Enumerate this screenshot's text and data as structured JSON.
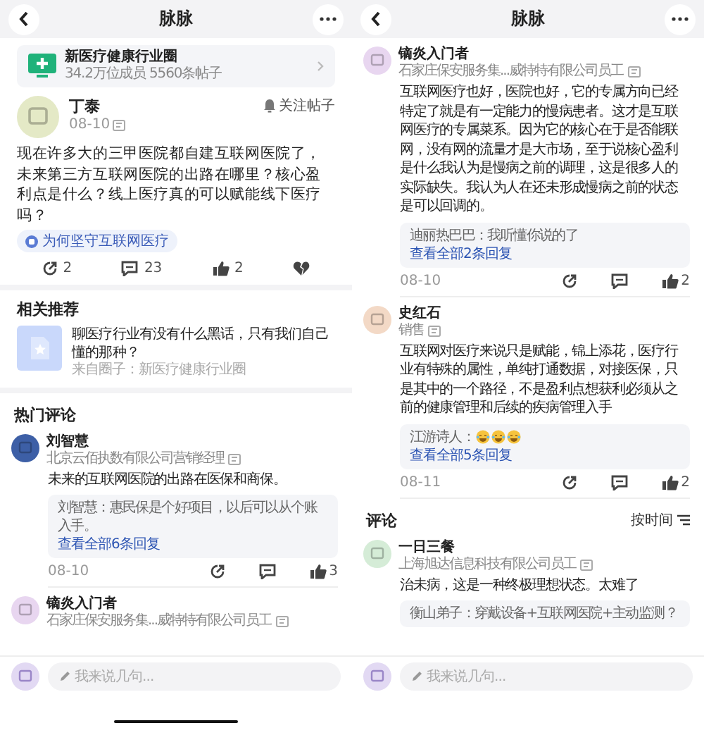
{
  "screens": [
    {
      "title": "脉脉",
      "home_indicator": true,
      "input": {
        "placeholder": "我来说几句..."
      },
      "blocks": [
        {
          "kind": "group",
          "name": "新医疗健康行业圈",
          "stats": "34.2万位成员 5560条帖子"
        },
        {
          "kind": "post",
          "author": "丁泰",
          "color": "#e4e9c6",
          "date": "08-10",
          "follow": "关注帖子",
          "text": "现在许多大的三甲医院都自建互联网医院了，未来第三方互联网医院的出路在哪里？核心盈利点是什么？线上医疗真的可以赋能线下医疗吗？",
          "tag": "为何坚守互联网医疗",
          "actions": [
            {
              "kind": "share",
              "count": "2"
            },
            {
              "kind": "comment",
              "count": "23"
            },
            {
              "kind": "like",
              "count": "2"
            },
            {
              "kind": "dislike"
            }
          ]
        },
        {
          "kind": "related",
          "title": "相关推荐",
          "text": "聊医疗行业有没有什么黑话，只有我们自己懂的那种？",
          "source": "来自圈子：新医疗健康行业圈"
        },
        {
          "kind": "section",
          "title": "热门评论"
        },
        {
          "kind": "comment",
          "author": "刘智慧",
          "color": "#3d5fa6",
          "subtitle": "北京云佰执数有限公司营销经理",
          "text": "未来的互联网医院的出路在医保和商保。",
          "reply": {
            "text": "刘智慧：惠民保是个好项目，以后可以从个账入手。",
            "more": "查看全部6条回复"
          },
          "date": "08-10",
          "like": "3"
        },
        {
          "kind": "comment",
          "author": "镝炎入门者",
          "color": "#e8d6f0",
          "subtitle": "石家庄保安服务集...威特特有限公司员工"
        }
      ]
    },
    {
      "title": "脉脉",
      "home_indicator": false,
      "input": {
        "placeholder": "我来说几句..."
      },
      "blocks": [
        {
          "kind": "comment",
          "author": "镝炎入门者",
          "color": "#e8d6f0",
          "subtitle": "石家庄保安服务集...威特特有限公司员工",
          "text": "互联网医疗也好，医院也好，它的专属方向已经特定了就是有一定能力的慢病患者。这才是互联网医疗的专属菜系。因为它的核心在于是否能联网，没有网的流量才是大市场，至于说核心盈利是什么我认为是慢病之前的调理，这是很多人的实际缺失。我认为人在还未形成慢病之前的状态是可以回调的。",
          "reply": {
            "text": "迪丽热巴巴：我听懂你说的了",
            "more": "查看全部2条回复"
          },
          "date": "08-10",
          "like": "2"
        },
        {
          "kind": "comment",
          "author": "史红石",
          "color": "#f3d9c6",
          "subtitle": "销售",
          "text": "互联网对医疗来说只是赋能，锦上添花，医疗行业有特殊的属性，单纯打通数据，对接医保，只是其中的一个路径，不是盈利点想获利必须从之前的健康管理和后续的疾病管理入手",
          "reply": {
            "text": "江游诗人：",
            "emojis": [
              {
                "kind": "laugh"
              },
              {
                "kind": "laugh"
              },
              {
                "kind": "laugh"
              }
            ],
            "more": "查看全部5条回复"
          },
          "date": "08-11",
          "like": "2"
        },
        {
          "kind": "section",
          "title": "评论",
          "sort": "按时间"
        },
        {
          "kind": "comment",
          "author": "一日三餐",
          "color": "#d5ecd7",
          "subtitle": "上海旭达信息科技有限公司员工",
          "text": "治未病，这是一种终极理想状态。太难了",
          "reply": {
            "text": "衡山弟子：穿戴设备+互联网医院+主动监测？"
          }
        }
      ]
    }
  ]
}
